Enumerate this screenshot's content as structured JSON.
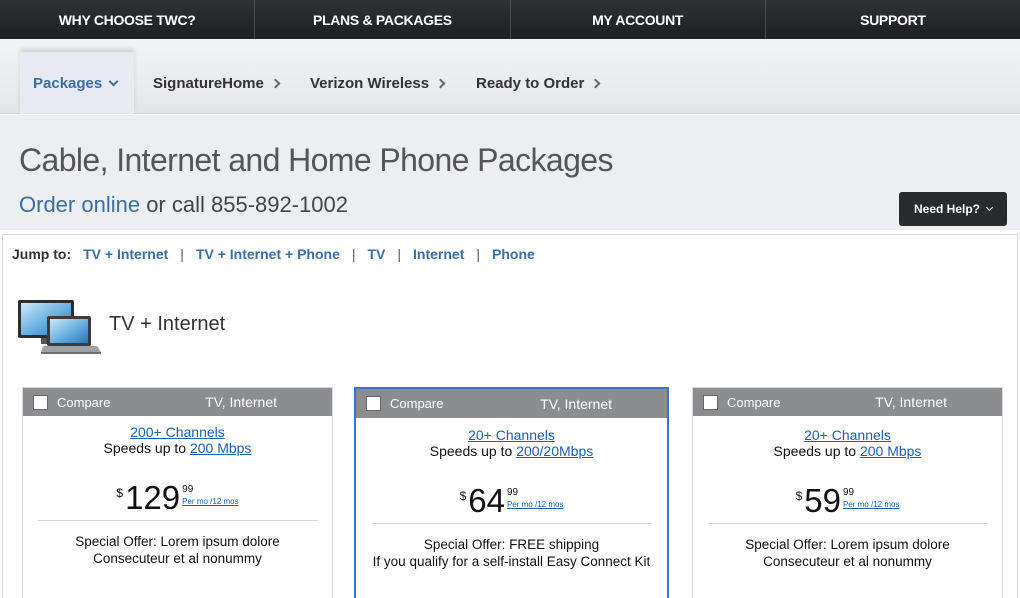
{
  "topnav": {
    "items": [
      "WHY CHOOSE TWC?",
      "PLANS & PACKAGES",
      "MY ACCOUNT",
      "SUPPORT"
    ]
  },
  "subnav": {
    "tabs": [
      {
        "label": "Packages",
        "active": true
      },
      {
        "label": "SignatureHome"
      },
      {
        "label": "Verizon Wireless"
      },
      {
        "label": "Ready to Order"
      }
    ]
  },
  "header": {
    "title": "Cable, Internet and Home Phone Packages",
    "order_link": "Order online",
    "order_text": " or call 855-892-1002",
    "help_button": "Need Help?"
  },
  "jump": {
    "label": "Jump to:",
    "links": [
      "TV + Internet",
      "TV + Internet + Phone",
      "TV",
      "Internet",
      "Phone"
    ],
    "separator": "|"
  },
  "section": {
    "title": "TV + Internet",
    "icon": "tv-laptop-icon"
  },
  "cards": [
    {
      "compare_label": "Compare",
      "services": "TV, Internet",
      "channels": "200+ Channels",
      "speed_prefix": "Speeds up to ",
      "speed": "200 Mbps",
      "currency": "$",
      "price": "129",
      "cents": "99",
      "per": "Per mo /12 mos",
      "offer_line1": "Special Offer: Lorem ipsum dolore",
      "offer_line2": "Consecuteur et al nonummy",
      "selected": false
    },
    {
      "compare_label": "Compare",
      "services": "TV, Internet",
      "channels": "20+ Channels",
      "speed_prefix": "Speeds up to ",
      "speed": "200/20Mbps",
      "currency": "$",
      "price": "64",
      "cents": "99",
      "per": "Per mo /12 mos",
      "offer_line1": "Special Offer: FREE shipping",
      "offer_line2": "If you qualify for a self-install Easy Connect Kit",
      "selected": true
    },
    {
      "compare_label": "Compare",
      "services": "TV, Internet",
      "channels": "20+ Channels",
      "speed_prefix": "Speeds up to ",
      "speed": "200 Mbps",
      "currency": "$",
      "price": "59",
      "cents": "99",
      "per": "Per mo /12 mos",
      "offer_line1": "Special Offer: Lorem ipsum dolore",
      "offer_line2": "Consecuteur et al nonummy",
      "selected": false
    }
  ],
  "colors": {
    "accent": "#3b6ea5",
    "link": "#1a5fb4",
    "selected_border": "#3b73c8",
    "topnav_bg": "#1e1f21"
  }
}
